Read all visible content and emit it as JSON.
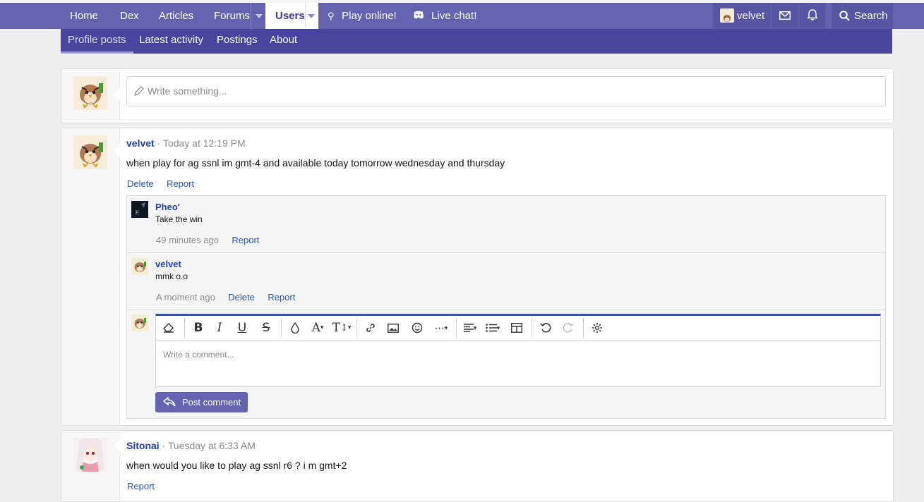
{
  "nav": {
    "home": "Home",
    "dex": "Dex",
    "articles": "Articles",
    "forums": "Forums",
    "users": "Users",
    "play": "Play online!",
    "chat": "Live chat!",
    "user": "velvet",
    "search": "Search"
  },
  "subnav": {
    "profile_posts": "Profile posts",
    "latest_activity": "Latest activity",
    "postings": "Postings",
    "about": "About"
  },
  "composer": {
    "placeholder": "Write something..."
  },
  "post1": {
    "user": "velvet",
    "time": "Today at 12:19 PM",
    "text": "when play for ag ssnl im gmt-4 and available today tomorrow wednesday and thursday",
    "delete": "Delete",
    "report": "Report",
    "comments": [
      {
        "user": "Pheo'",
        "text": "Take the win",
        "time": "49 minutes ago",
        "report": "Report"
      },
      {
        "user": "velvet",
        "text": "mmk o.o",
        "time": "A moment ago",
        "delete": "Delete",
        "report": "Report"
      }
    ],
    "editor": {
      "placeholder": "Write a comment...",
      "post_label": "Post comment"
    }
  },
  "post2": {
    "user": "Sitonai",
    "time": "Tuesday at 6:33 AM",
    "text": "when would you like to play ag ssnl r6 ? i m gmt+2",
    "report": "Report"
  },
  "icons": [
    "pencil-icon",
    "discord-icon",
    "envelope-icon",
    "bell-icon",
    "search-icon",
    "eraser-icon",
    "bold-icon",
    "italic-icon",
    "underline-icon",
    "strikethrough-icon",
    "color-icon",
    "font-icon",
    "text-size-icon",
    "link-icon",
    "image-icon",
    "smile-icon",
    "more-icon",
    "align-icon",
    "list-icon",
    "table-icon",
    "undo-icon",
    "redo-icon",
    "gear-icon",
    "reply-icon"
  ],
  "colors": {
    "nav": "#6762b0",
    "subnav": "#4b449f",
    "accent": "#2141a8",
    "button": "#6762b0"
  }
}
